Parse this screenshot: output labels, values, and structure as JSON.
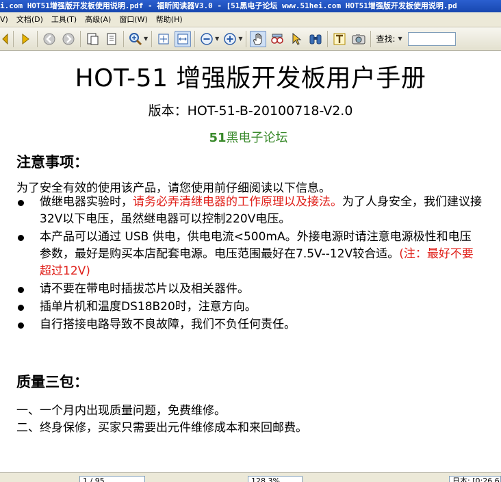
{
  "window": {
    "title": "i.com HOT51增强版开发板使用说明.pdf - 福昕阅读器V3.0 - [51黑电子论坛 www.51hei.com HOT51增强版开发板使用说明.pd"
  },
  "menu": {
    "items": [
      "V)",
      "文档(D)",
      "工具(T)",
      "高级(A)",
      "窗口(W)",
      "帮助(H)"
    ]
  },
  "toolbar": {
    "find_label": "查找:",
    "find_value": ""
  },
  "document": {
    "title": "HOT-51 增强版开发板用户手册",
    "version": "版本：HOT-51-B-20100718-V2.0",
    "forum_num": "51",
    "forum_text": "黑电子论坛",
    "notice_heading": "注意事项：",
    "notice_intro": "为了安全有效的使用该产品，请您使用前仔细阅读以下信息。",
    "bullet1_a": "做继电器实验时，",
    "bullet1_red": "请务必弄清继电器的工作原理以及接法。",
    "bullet1_b": "为了人身安全，我们建议接32V以下电压，虽然继电器可以控制220V电压。",
    "bullet2_a": "本产品可以通过 USB 供电，供电电流<500mA。外接电源时请注意电源极性和电压参数，最好是购买本店配套电源。电压范围最好在7.5V--12V较合适。",
    "bullet2_red": "(注：最好不要超过12V)",
    "bullet3": "请不要在带电时插拔芯片以及相关器件。",
    "bullet4": "插单片机和温度DS18B20时，注意方向。",
    "bullet5": "自行搭接电路导致不良故障，我们不负任何责任。",
    "quality_heading": "质量三包：",
    "quality1": "一、一个月内出现质量问题，免费维修。",
    "quality2": "二、终身保修，买家只需要出元件维修成本和来回邮费。"
  },
  "statusbar": {
    "page": "1 / 95",
    "zoom": "128.3%",
    "time": "日本: [0:26 6"
  },
  "colors": {
    "accent_red": "#e0201a",
    "forum_green": "#3a8a2c",
    "titlebar_blue": "#1747b0"
  }
}
